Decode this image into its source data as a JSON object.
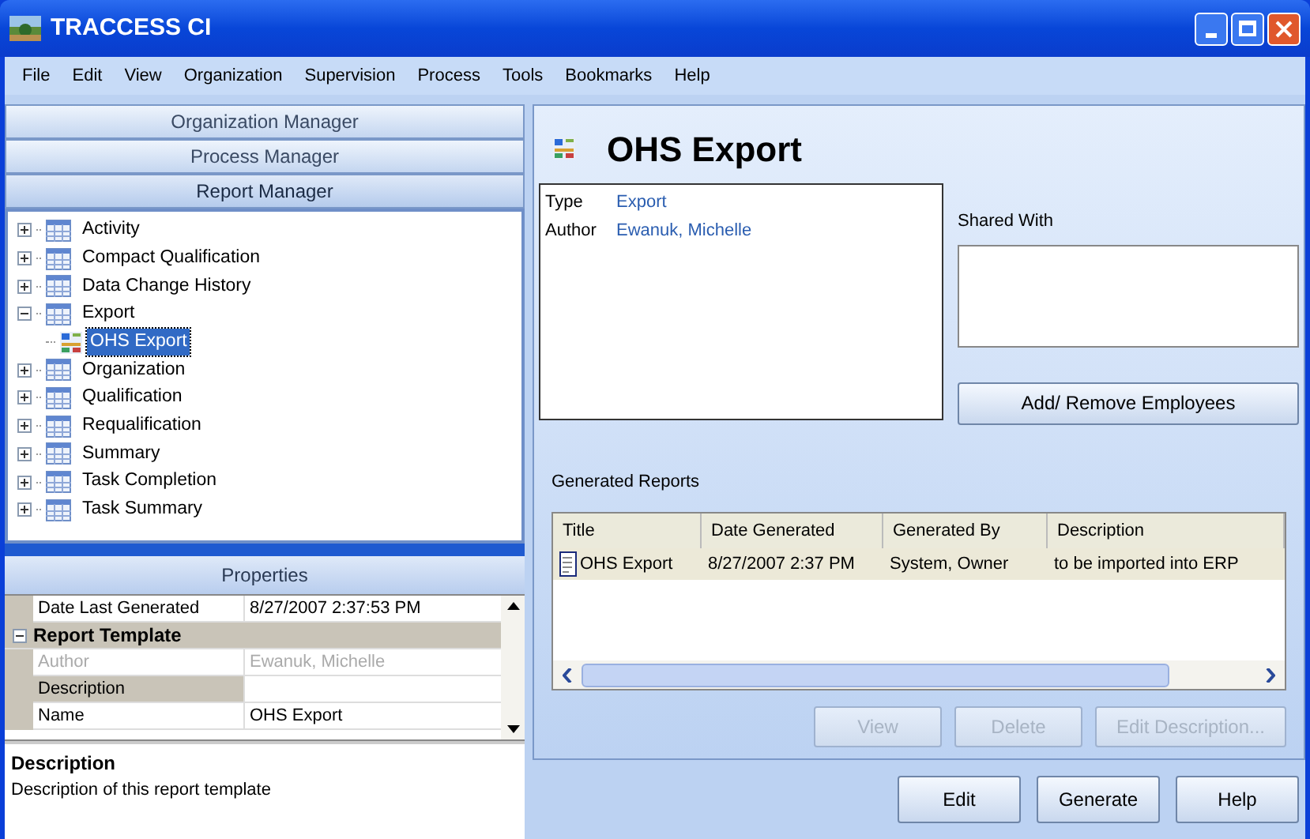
{
  "window": {
    "title": "TRACCESS CI"
  },
  "menu": [
    "File",
    "Edit",
    "View",
    "Organization",
    "Supervision",
    "Process",
    "Tools",
    "Bookmarks",
    "Help"
  ],
  "managers": [
    {
      "label": "Organization Manager",
      "selected": false
    },
    {
      "label": "Process Manager",
      "selected": false
    },
    {
      "label": "Report Manager",
      "selected": true
    }
  ],
  "tree": [
    {
      "label": "Activity",
      "expanded": false,
      "selected": false
    },
    {
      "label": "Compact Qualification",
      "expanded": false,
      "selected": false
    },
    {
      "label": "Data Change History",
      "expanded": false,
      "selected": false
    },
    {
      "label": "Export",
      "expanded": true,
      "selected": false,
      "children": [
        {
          "label": "OHS Export",
          "selected": true
        }
      ]
    },
    {
      "label": "Organization",
      "expanded": false,
      "selected": false
    },
    {
      "label": "Qualification",
      "expanded": false,
      "selected": false
    },
    {
      "label": "Requalification",
      "expanded": false,
      "selected": false
    },
    {
      "label": "Summary",
      "expanded": false,
      "selected": false
    },
    {
      "label": "Task Completion",
      "expanded": false,
      "selected": false
    },
    {
      "label": "Task Summary",
      "expanded": false,
      "selected": false
    }
  ],
  "properties": {
    "title": "Properties",
    "rows": [
      {
        "kind": "property",
        "name": "Date Last Generated",
        "value": "8/27/2007 2:37:53 PM",
        "disabled": false,
        "selected": false
      },
      {
        "kind": "category",
        "name": "Report Template",
        "expanded": true
      },
      {
        "kind": "property",
        "name": "Author",
        "value": "Ewanuk, Michelle",
        "disabled": true,
        "selected": false
      },
      {
        "kind": "property",
        "name": "Description",
        "disabled": false,
        "selected": true
      },
      {
        "kind": "property",
        "name": "Name",
        "value": "OHS Export",
        "disabled": false,
        "selected": false
      }
    ],
    "help_title": "Description",
    "help_text": "Description of this report template"
  },
  "report": {
    "title": "OHS Export",
    "info": [
      {
        "label": "Type",
        "value": "Export"
      },
      {
        "label": "Author",
        "value": "Ewanuk, Michelle"
      }
    ],
    "shared_with_label": "Shared With",
    "add_remove_button": "Add/ Remove Employees",
    "generated_label": "Generated Reports",
    "table": {
      "columns": [
        "Title",
        "Date Generated",
        "Generated By",
        "Description"
      ],
      "rows": [
        {
          "cells": [
            "OHS Export",
            "8/27/2007 2:37 PM",
            "System, Owner",
            "to be imported into ERP"
          ],
          "selected": true
        }
      ]
    },
    "table_buttons": [
      {
        "label": "View",
        "disabled": true
      },
      {
        "label": "Delete",
        "disabled": true
      },
      {
        "label": "Edit Description...",
        "disabled": true
      }
    ]
  },
  "footer_buttons": [
    {
      "label": "Edit",
      "disabled": false
    },
    {
      "label": "Generate",
      "disabled": false
    },
    {
      "label": "Help",
      "disabled": false
    }
  ]
}
